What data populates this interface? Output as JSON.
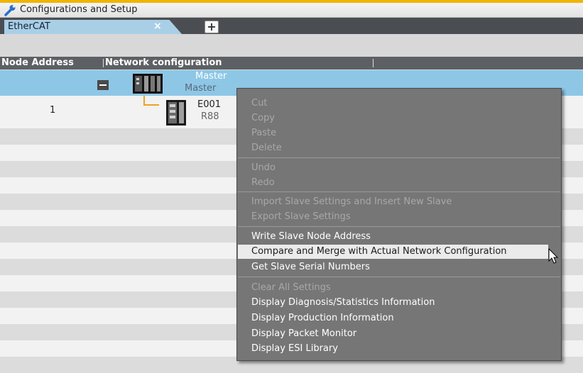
{
  "window": {
    "title": "Configurations and Setup"
  },
  "tabs": [
    {
      "label": "EtherCAT",
      "close": "×"
    }
  ],
  "add_tab": "+",
  "columns": {
    "node_address": "Node Address",
    "network_configuration": "Network configuration"
  },
  "master": {
    "name": "Master",
    "model": "Master"
  },
  "slave": {
    "node": "1",
    "name": "E001",
    "model": "R88"
  },
  "context_menu": {
    "items": [
      {
        "label": "Cut",
        "enabled": false
      },
      {
        "label": "Copy",
        "enabled": false
      },
      {
        "label": "Paste",
        "enabled": false
      },
      {
        "label": "Delete",
        "enabled": false
      },
      {
        "label": "Undo",
        "enabled": false
      },
      {
        "label": "Redo",
        "enabled": false
      },
      {
        "label": "Import Slave Settings and Insert New Slave",
        "enabled": false
      },
      {
        "label": "Export Slave Settings",
        "enabled": false
      },
      {
        "label": "Write Slave Node Address",
        "enabled": true
      },
      {
        "label": "Compare and Merge with Actual Network Configuration",
        "enabled": true,
        "highlighted": true
      },
      {
        "label": "Get Slave Serial Numbers",
        "enabled": true
      },
      {
        "label": "Clear All Settings",
        "enabled": false
      },
      {
        "label": "Display Diagnosis/Statistics Information",
        "enabled": true
      },
      {
        "label": "Display Production Information",
        "enabled": true
      },
      {
        "label": "Display Packet Monitor",
        "enabled": true
      },
      {
        "label": "Display ESI Library",
        "enabled": true
      }
    ]
  },
  "colors": {
    "accent": "#f0b400",
    "tab_active": "#a9cfe7",
    "selected_row": "#8ec7e6",
    "menu_bg": "#767676",
    "menu_highlight": "#ebebeb"
  },
  "icons": [
    "wrench-icon",
    "close-icon",
    "plus-icon",
    "collapse-icon",
    "plc-master-icon",
    "servo-drive-icon",
    "mouse-pointer-icon"
  ]
}
